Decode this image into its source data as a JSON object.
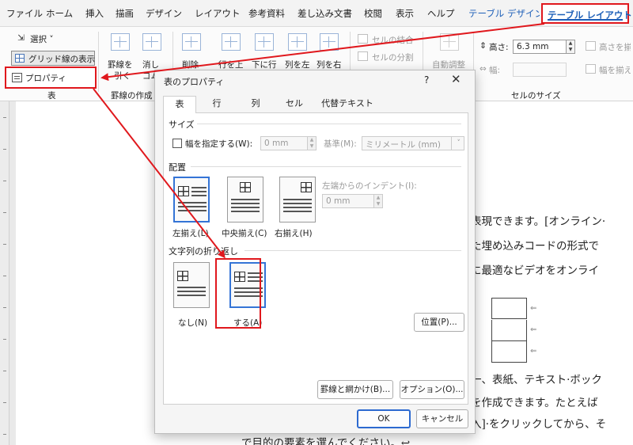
{
  "menubar": {
    "tabs": [
      "ファイル",
      "ホーム",
      "挿入",
      "描画",
      "デザイン",
      "レイアウト",
      "参考資料",
      "差し込み文書",
      "校閲",
      "表示",
      "ヘルプ"
    ],
    "table_design": "テーブル デザイン",
    "table_layout": "テーブル レイアウト"
  },
  "ribbon": {
    "select": "選択 ˅",
    "grid_lines": "グリッド線の表示",
    "properties": "プロパティ",
    "group_table": "表",
    "draw_borders_1": "罫線を",
    "draw_borders_2": "引く",
    "eraser_1": "消し",
    "eraser_2": "ゴム",
    "group_draw": "罫線の作成",
    "delete": "削除",
    "insert_above": "行を上",
    "insert_below": "下に行",
    "insert_left": "列を左",
    "insert_right": "列を右",
    "merge_cells": "セルの結合",
    "split_cells": "セルの分割",
    "autofit": "自動調整",
    "height_label": "高さ:",
    "height_value": "6.3 mm",
    "width_label": "幅:",
    "distribute_rows": "高さを揃える",
    "distribute_cols": "幅を揃える",
    "group_cell_size": "セルのサイズ"
  },
  "document": {
    "lines": [
      "表現できます。[オンライン·",
      "た埋め込みコードの形式で",
      "に最適なビデオをオンライ",
      "一、表紙、テキスト·ボック",
      "を作成できます。たとえば",
      "入]·をクリックしてから、そ",
      "で目的の要素を選んでください。↩"
    ],
    "row_marks": [
      "⇐",
      "⇐",
      "⇐"
    ]
  },
  "dialog": {
    "title": "表のプロパティ",
    "help": "?",
    "close": "✕",
    "tabs": [
      "表",
      "行",
      "列",
      "セル",
      "代替テキスト"
    ],
    "size_section": "サイズ",
    "preferred_width": "幅を指定する(W):",
    "width_value": "0 mm",
    "measure_label": "基準(M):",
    "measure_value": "ミリメートル (mm)",
    "alignment_section": "配置",
    "align_left": "左揃え(L)",
    "align_center": "中央揃え(C)",
    "align_right": "右揃え(H)",
    "indent_label": "左端からのインデント(I):",
    "indent_value": "0 mm",
    "wrap_section": "文字列の折り返し",
    "wrap_none": "なし(N)",
    "wrap_around": "する(A)",
    "position_button": "位置(P)...",
    "borders_button": "罫線と網かけ(B)...",
    "options_button": "オプション(O)...",
    "ok_button": "OK",
    "cancel_button": "キャンセル"
  },
  "colors": {
    "highlight_red": "#e0181d",
    "accent_blue": "#1d5fb8",
    "selection_blue": "#3474d6"
  }
}
